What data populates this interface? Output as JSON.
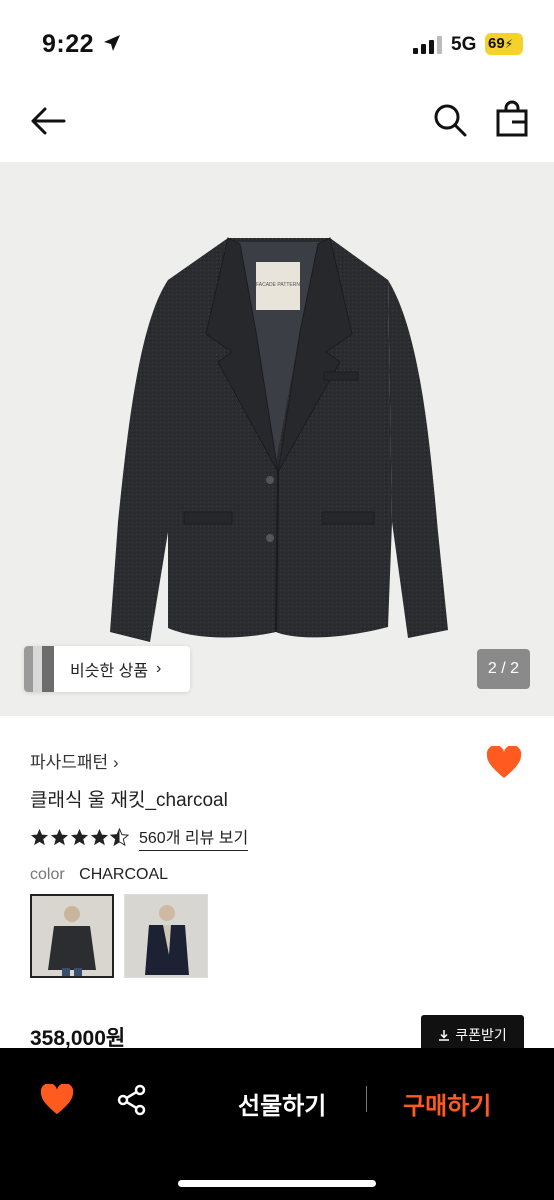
{
  "status": {
    "time": "9:22",
    "network": "5G",
    "battery": "69"
  },
  "nav": {
    "back_icon": "arrow-left-icon",
    "search_icon": "search-icon",
    "bag_icon": "shopping-bag-icon"
  },
  "gallery": {
    "similar_label": "비슷한 상품",
    "pager": "2 / 2",
    "jacket_tag": "FACADE PATTERN"
  },
  "product": {
    "brand": "파사드패턴",
    "name": "클래식 울 재킷_charcoal",
    "rating": 4.5,
    "reviews": "560개 리뷰 보기",
    "color_label": "color",
    "color_value": "CHARCOAL",
    "price": "358,000원",
    "coupon": "쿠폰받기",
    "liked": true
  },
  "colors": {
    "accent": "#ff5a1f",
    "dark": "#000000"
  },
  "bottom_bar": {
    "gift": "선물하기",
    "buy": "구매하기"
  }
}
